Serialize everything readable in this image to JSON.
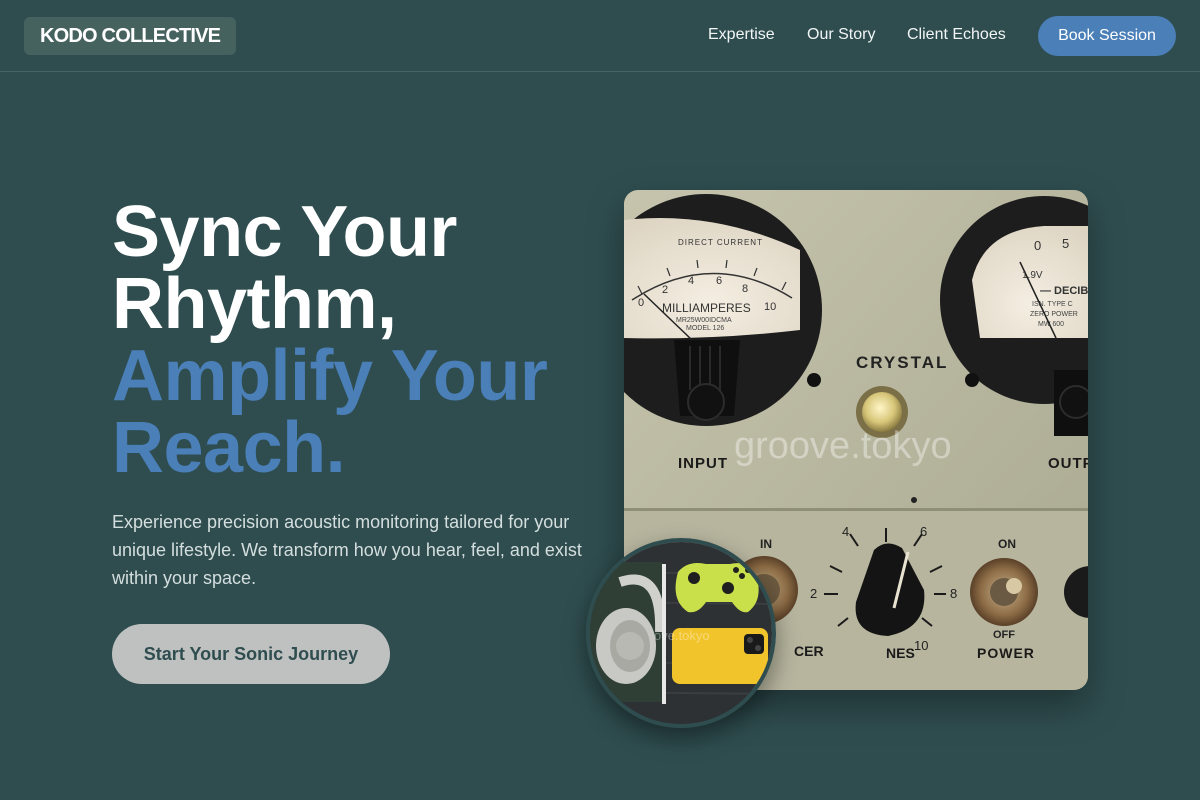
{
  "header": {
    "logo": "KODO COLLECTIVE",
    "nav": [
      "Expertise",
      "Our Story",
      "Client Echoes"
    ],
    "cta": "Book Session"
  },
  "hero": {
    "headline_white": [
      "Sync Your",
      "Rhythm,"
    ],
    "headline_blue": [
      "Amplify Your",
      "Reach."
    ],
    "description": "Experience precision acoustic monitoring tailored for your unique lifestyle. We transform how you hear, feel, and exist within your space.",
    "button": "Start Your Sonic Journey"
  },
  "main_image": {
    "meter_left": {
      "top_label": "DIRECT CURRENT",
      "scale": [
        "0",
        "2",
        "4",
        "6",
        "8",
        "10"
      ],
      "unit": "MILLIAMPERES",
      "model_line1": "MR25W00IDCMA",
      "model_line2": "MODEL 126"
    },
    "meter_right": {
      "scale": [
        "0",
        "5"
      ],
      "unit": "— DECIB",
      "voltage": "1.9V",
      "lines": [
        "ISN. TYPE C",
        "ZERO POWER",
        "MW 600"
      ]
    },
    "labels": {
      "crystal": "CRYSTAL",
      "input": "INPUT",
      "output": "OUTP",
      "in": "IN",
      "on": "ON",
      "off": "OFF",
      "power": "POWER",
      "cer": "CER",
      "nes": "NES",
      "dial_numbers": [
        "2",
        "4",
        "6",
        "8",
        "10"
      ]
    },
    "watermark": "groove.tokyo"
  },
  "inset_image": {
    "watermark": "ove.tokyo"
  },
  "colors": {
    "background": "#2f4d4f",
    "accent": "#4a7fb8",
    "cta_button": "#bfc1c1",
    "logo_bg": "#46625f"
  }
}
